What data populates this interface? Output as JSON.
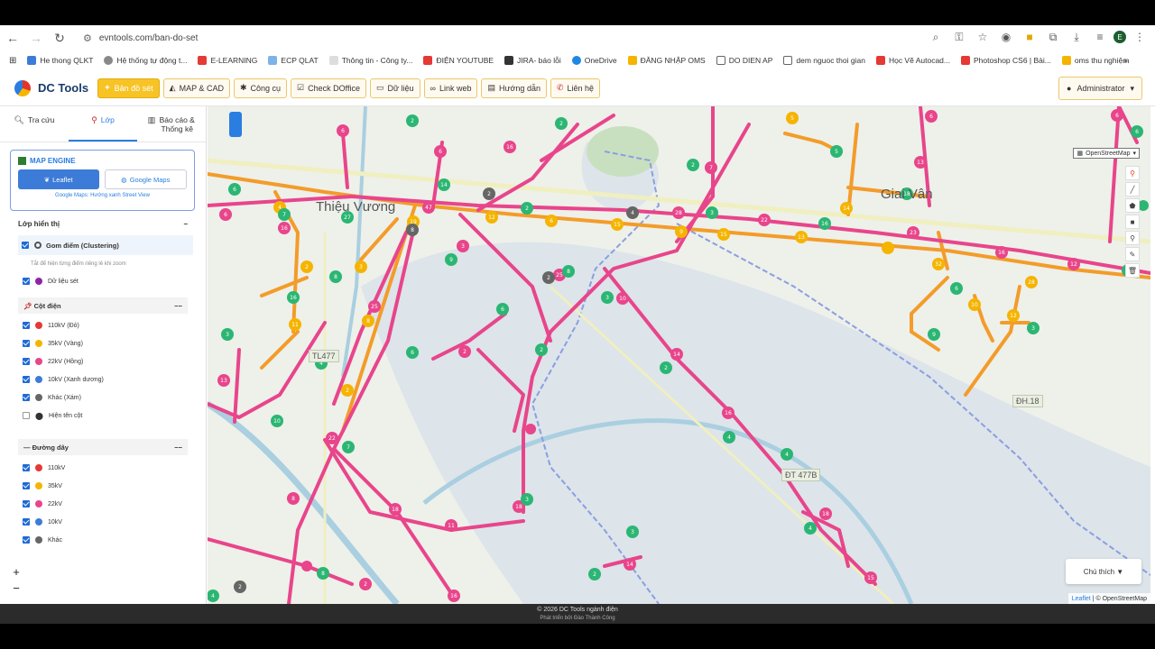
{
  "browser": {
    "url": "evntools.com/ban-do-set",
    "profile_initial": "E",
    "bookmarks": [
      "He thong QLKT",
      "Hệ thống tự động t...",
      "E-LEARNING",
      "ECP QLAT",
      "Thông tin - Công ty...",
      "ĐIỆN YOUTUBE",
      "JIRA- báo lỗi",
      "OneDrive",
      "ĐĂNG NHẬP OMS",
      "DO DIEN AP",
      "dem nguoc thoi gian",
      "Học Vẽ Autocad...",
      "Photoshop CS6 | Bài...",
      "oms thu nghiệm"
    ]
  },
  "app": {
    "name": "DC Tools",
    "nav": [
      "Bản đồ sét",
      "MAP & CAD",
      "Công cụ",
      "Check DOffice",
      "Dữ liệu",
      "Link web",
      "Hướng dẫn",
      "Liên hệ"
    ],
    "user": "Administrator"
  },
  "sidebar": {
    "tabs": [
      "Tra cứu",
      "Lớp",
      "Báo cáo & Thống kê"
    ],
    "engine": {
      "title": "MAP ENGINE",
      "leaflet": "Leaflet",
      "google": "Google Maps",
      "note": "Google Maps: Hướng xanh Street View"
    },
    "visible_layers": "Lớp hiển thị",
    "clustering": "Gom điểm (Clustering)",
    "clustering_note": "Tắt để hiện từng điểm riêng lẻ khi zoom",
    "lightning_data": "Dữ liệu sét",
    "poles_title": "Cột điện",
    "poles": [
      {
        "label": "110kV (Đỏ)",
        "color": "#e53935",
        "checked": true
      },
      {
        "label": "35kV (Vàng)",
        "color": "#f5b400",
        "checked": true
      },
      {
        "label": "22kV (Hồng)",
        "color": "#e8458b",
        "checked": true
      },
      {
        "label": "10kV (Xanh dương)",
        "color": "#3d7bd8",
        "checked": true
      },
      {
        "label": "Khác (Xám)",
        "color": "#666666",
        "checked": true
      },
      {
        "label": "Hiện tên cột",
        "color": "#333333",
        "checked": false
      }
    ],
    "lines_title": "Đường dây",
    "lines": [
      {
        "label": "110kV",
        "color": "#e53935"
      },
      {
        "label": "35kV",
        "color": "#f5b400"
      },
      {
        "label": "22kV",
        "color": "#e8458b"
      },
      {
        "label": "10kV",
        "color": "#3d7bd8"
      },
      {
        "label": "Khác",
        "color": "#666666"
      }
    ]
  },
  "map": {
    "labels": [
      "Thiệu Vương",
      "Giai Vân"
    ],
    "road_tags": [
      "TL477",
      "ĐT 477B",
      "ĐH.18"
    ],
    "layer_select": "OpenStreetMap",
    "legend_button": "Chú thích ▼",
    "attribution_leaflet": "Leaflet",
    "attribution_osm": "| © OpenStreetMap"
  },
  "footer": {
    "line1": "© 2026 DC Tools ngành điện",
    "line2": "Phát triển bởi Đào Thành Công"
  }
}
